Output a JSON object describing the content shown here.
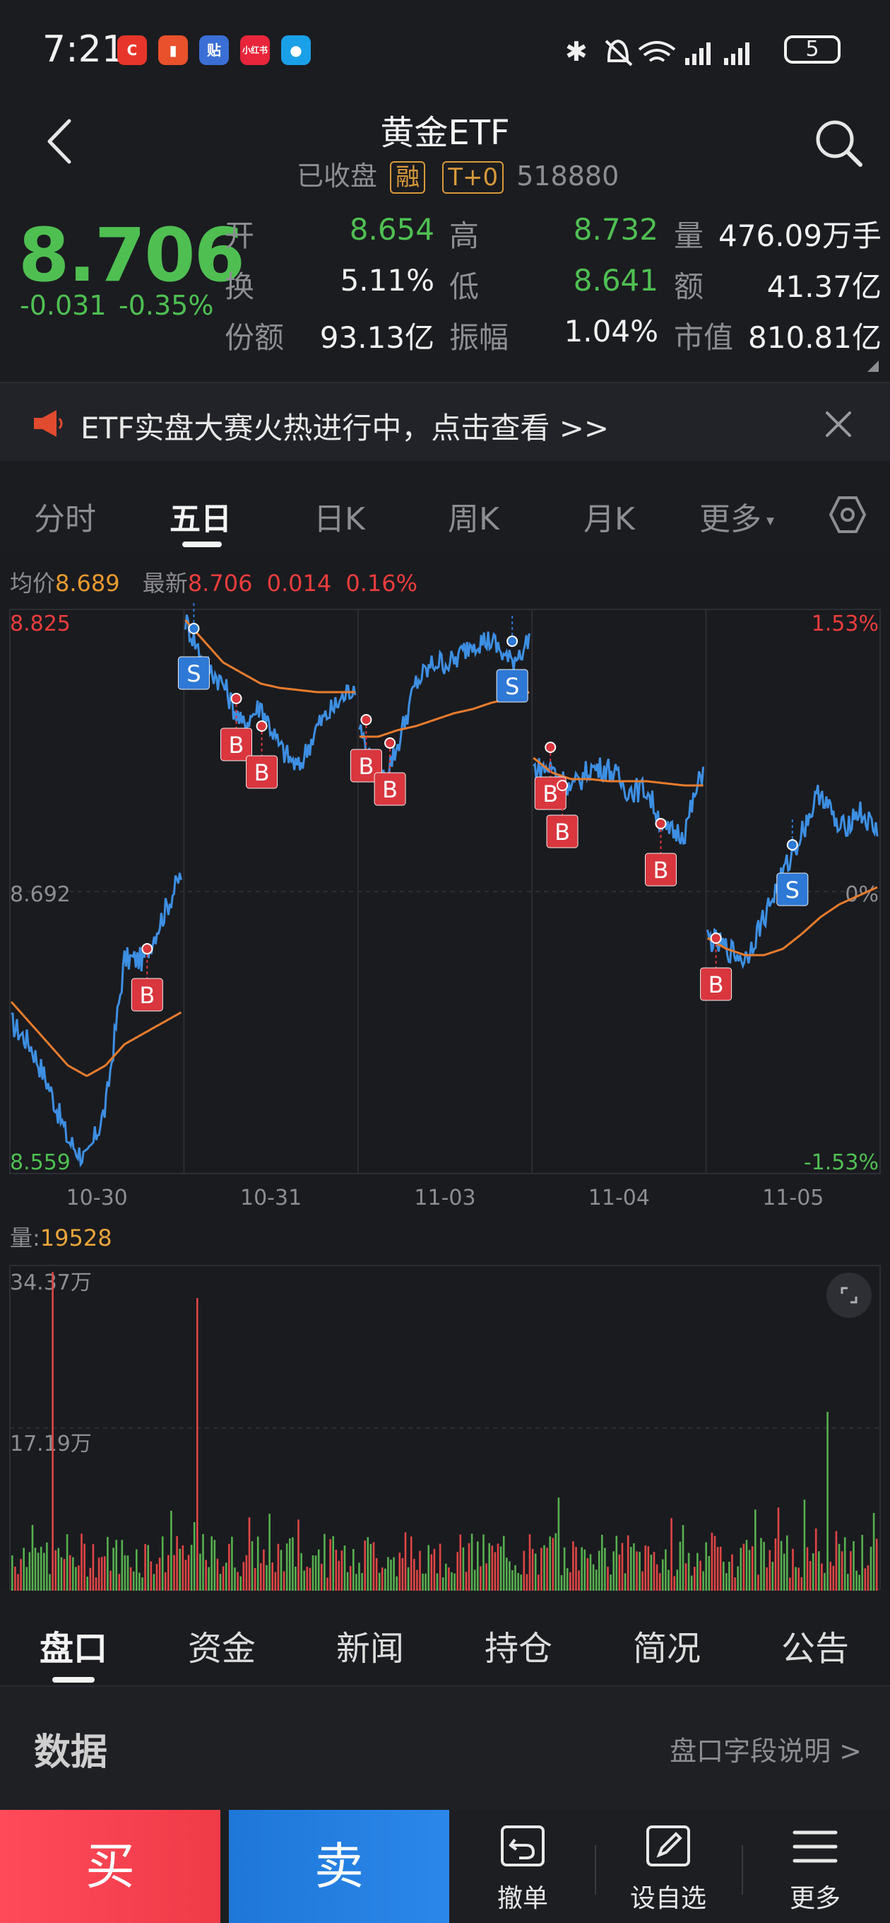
{
  "status_bar": {
    "time": "7:21",
    "apps": [
      {
        "text": "C",
        "color": "#e8352b"
      },
      {
        "text": "▮",
        "color": "#e8512b"
      },
      {
        "text": "贴",
        "color": "#3b6fd6"
      },
      {
        "text": "小红书",
        "color": "#e8253b"
      },
      {
        "text": "●",
        "color": "#1aa0e8"
      }
    ],
    "battery": "5"
  },
  "header": {
    "title": "黄金ETF",
    "status": "已收盘",
    "tag_margin": "融",
    "tag_t0": "T+0",
    "code": "518880"
  },
  "quote": {
    "price": "8.706",
    "change": "-0.031",
    "change_pct": "-0.35%",
    "fields": [
      {
        "label": "开",
        "value": "8.654",
        "color": "#4fbf52"
      },
      {
        "label": "高",
        "value": "8.732",
        "color": "#4fbf52"
      },
      {
        "label": "量",
        "value": "476.09万手",
        "color": "#f2f2f2"
      },
      {
        "label": "换",
        "value": "5.11%",
        "color": "#f2f2f2"
      },
      {
        "label": "低",
        "value": "8.641",
        "color": "#4fbf52"
      },
      {
        "label": "额",
        "value": "41.37亿",
        "color": "#f2f2f2"
      },
      {
        "label": "份额",
        "value": "93.13亿",
        "color": "#f2f2f2"
      },
      {
        "label": "振幅",
        "value": "1.04%",
        "color": "#f2f2f2"
      },
      {
        "label": "市值",
        "value": "810.81亿",
        "color": "#f2f2f2"
      }
    ]
  },
  "banner": {
    "text": "ETF实盘大赛火热进行中，点击查看 >>"
  },
  "chart_tabs": [
    "分时",
    "五日",
    "日K",
    "周K",
    "月K",
    "更多"
  ],
  "chart_tabs_active": 1,
  "legend": {
    "avg_label": "均价",
    "avg_value": "8.689",
    "last_label": "最新",
    "last_value": "8.706",
    "last_change": "0.014",
    "last_change_pct": "0.16%"
  },
  "volume_legend": {
    "label": "量:",
    "value": "19528"
  },
  "chart_data": {
    "type": "line",
    "title": "",
    "y_left_ticks": [
      "8.825",
      "8.692",
      "8.559"
    ],
    "y_right_ticks": [
      "1.53%",
      "0%",
      "-1.53%"
    ],
    "ylim": [
      8.559,
      8.825
    ],
    "x_ticks": [
      "10-30",
      "10-31",
      "11-03",
      "11-04",
      "11-05"
    ],
    "series": [
      {
        "name": "",
        "color": "#3d8fe3",
        "days": [
          [
            8.63,
            8.62,
            8.6,
            8.575,
            8.565,
            8.59,
            8.66,
            8.66,
            8.68,
            8.7
          ],
          [
            8.82,
            8.8,
            8.79,
            8.77,
            8.78,
            8.76,
            8.75,
            8.77,
            8.78,
            8.79
          ],
          [
            8.77,
            8.74,
            8.76,
            8.79,
            8.8,
            8.8,
            8.81,
            8.81,
            8.8,
            8.81
          ],
          [
            8.75,
            8.75,
            8.74,
            8.75,
            8.75,
            8.74,
            8.74,
            8.72,
            8.72,
            8.75
          ],
          [
            8.67,
            8.665,
            8.66,
            8.68,
            8.7,
            8.72,
            8.74,
            8.72,
            8.73,
            8.72
          ]
        ]
      },
      {
        "name": "",
        "color": "#e87c2e",
        "days": [
          [
            8.64,
            8.63,
            8.62,
            8.61,
            8.605,
            8.61,
            8.62,
            8.625,
            8.63,
            8.635
          ],
          [
            8.82,
            8.81,
            8.8,
            8.795,
            8.79,
            8.788,
            8.787,
            8.786,
            8.786,
            8.786
          ],
          [
            8.765,
            8.765,
            8.768,
            8.77,
            8.773,
            8.776,
            8.778,
            8.781,
            8.783,
            8.786
          ],
          [
            8.755,
            8.748,
            8.745,
            8.745,
            8.744,
            8.744,
            8.744,
            8.743,
            8.742,
            8.742
          ],
          [
            8.67,
            8.665,
            8.662,
            8.662,
            8.665,
            8.672,
            8.68,
            8.686,
            8.69,
            8.694
          ]
        ]
      }
    ],
    "markers": [
      {
        "label": "B",
        "day": 0,
        "pos": 0.8,
        "price": 8.665
      },
      {
        "label": "S",
        "day": 1,
        "pos": 0.05,
        "price": 8.816
      },
      {
        "label": "B",
        "day": 1,
        "pos": 0.3,
        "price": 8.783
      },
      {
        "label": "B",
        "day": 1,
        "pos": 0.45,
        "price": 8.77
      },
      {
        "label": "B",
        "day": 2,
        "pos": 0.04,
        "price": 8.773
      },
      {
        "label": "B",
        "day": 2,
        "pos": 0.18,
        "price": 8.762
      },
      {
        "label": "S",
        "day": 2,
        "pos": 0.9,
        "price": 8.81
      },
      {
        "label": "B",
        "day": 3,
        "pos": 0.1,
        "price": 8.76
      },
      {
        "label": "B",
        "day": 3,
        "pos": 0.17,
        "price": 8.742
      },
      {
        "label": "B",
        "day": 3,
        "pos": 0.75,
        "price": 8.724
      },
      {
        "label": "B",
        "day": 4,
        "pos": 0.05,
        "price": 8.67
      },
      {
        "label": "S",
        "day": 4,
        "pos": 0.5,
        "price": 8.714
      }
    ]
  },
  "volume_chart": {
    "y_ticks": [
      "34.37万",
      "17.19万"
    ],
    "max": 34.37
  },
  "info_tabs": [
    "盘口",
    "资金",
    "新闻",
    "持仓",
    "简况",
    "公告"
  ],
  "info_tabs_active": 0,
  "data_section": {
    "title": "数据",
    "link": "盘口字段说明 >"
  },
  "actions": {
    "buy": "买",
    "sell": "卖",
    "cancel": "撤单",
    "watchlist": "设自选",
    "more": "更多"
  }
}
